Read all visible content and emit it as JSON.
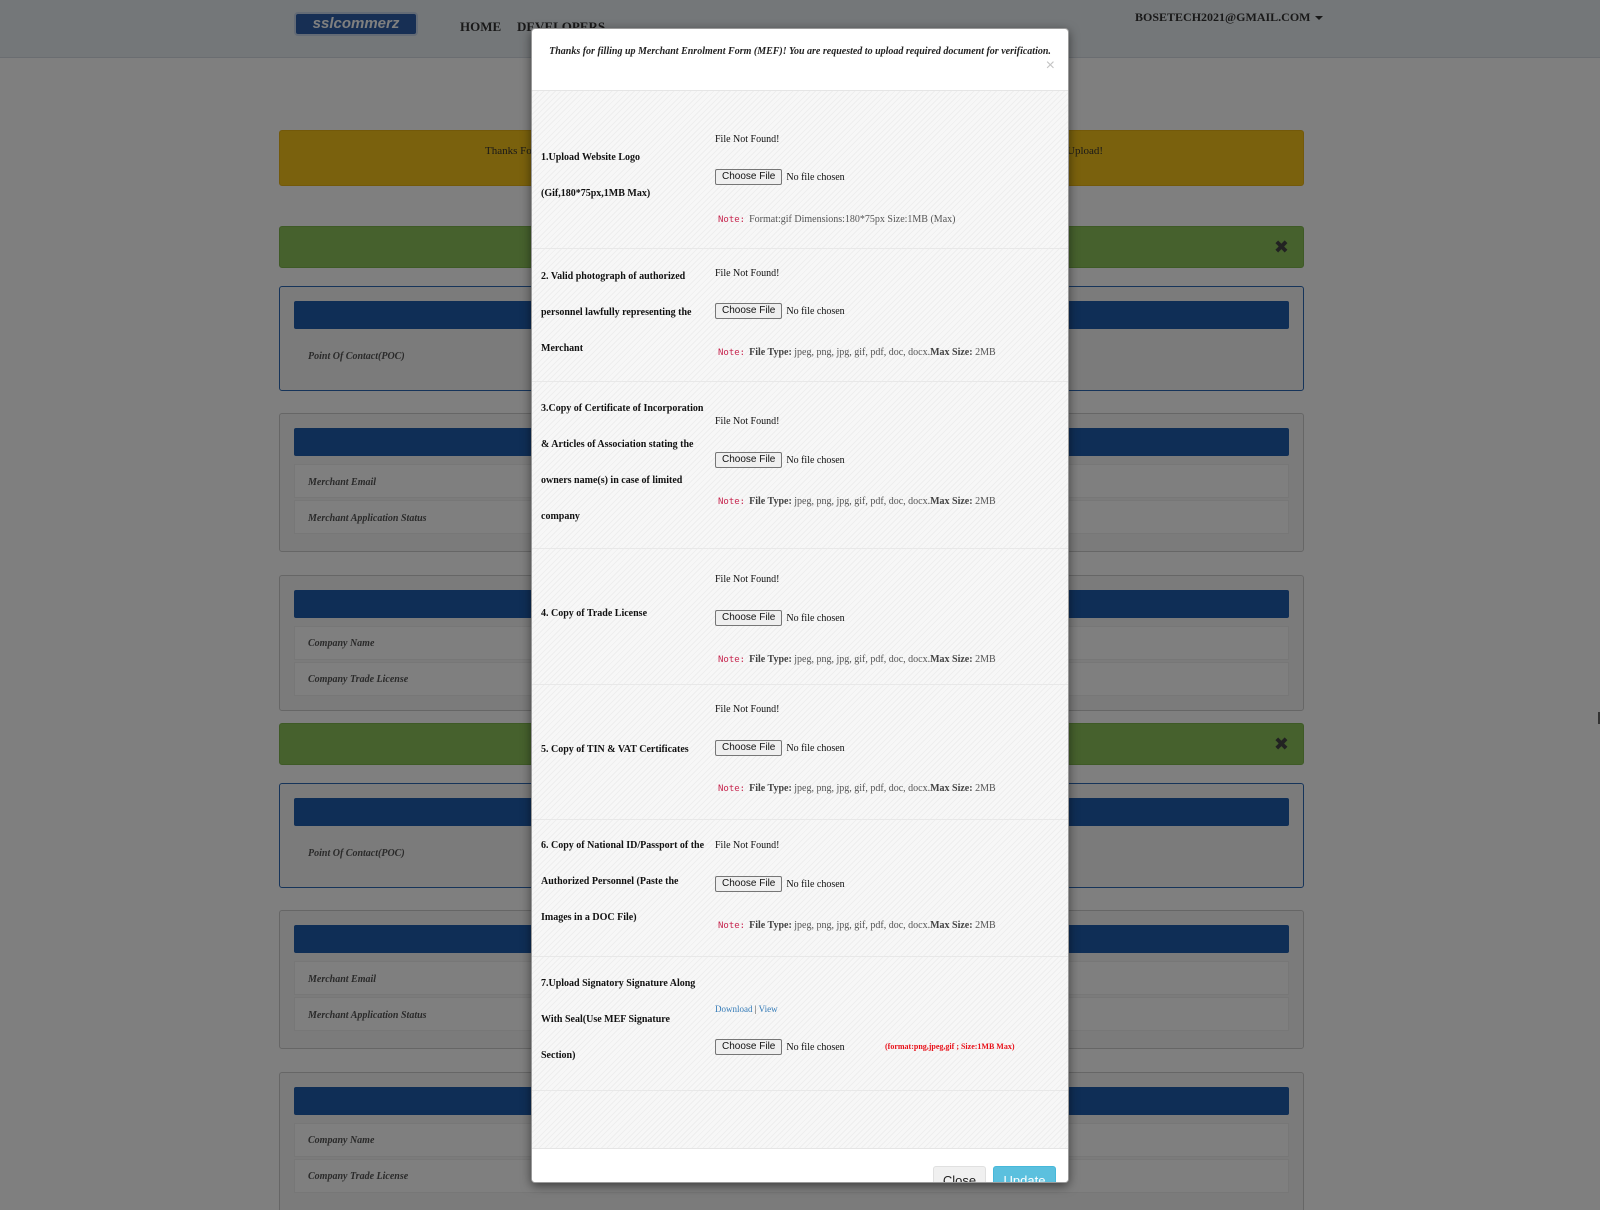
{
  "navbar": {
    "logo": "sslcommerz",
    "links": [
      "HOME",
      "DEVELOPERS"
    ],
    "user": "BOSETECH2021@GMAIL.COM"
  },
  "background": {
    "alert_left": "Thanks Fo",
    "alert_right": "Upload!",
    "labels": {
      "poc": "Point Of Contact(POC)",
      "merchant_email": "Merchant Email",
      "merchant_status": "Merchant Application Status",
      "company_name": "Company Name",
      "company_trade_license": "Company Trade License"
    }
  },
  "modal": {
    "title": "Thanks for filling up Merchant Enrolment Form (MEF)! You are requested to upload required document for verification.",
    "close_symbol": "×",
    "choose_label": "Choose File",
    "no_file_label": "No file chosen",
    "note_tag": "Note:",
    "file_type_label": "File Type:",
    "max_size_label": "Max Size:",
    "documents": [
      {
        "label_lines": [
          "1.Upload Website Logo",
          "(Gif,180*75px,1MB Max)"
        ],
        "status": "File Not Found!",
        "note_text": "Format:gif Dimensions:180*75px Size:1MB (Max)"
      },
      {
        "label_lines": [
          "2. Valid photograph of authorized",
          "personnel lawfully representing the",
          "Merchant"
        ],
        "status": "File Not Found!",
        "file_types": "jpeg, png, jpg, gif, pdf, doc, docx.",
        "max_size": "2MB"
      },
      {
        "label_lines": [
          "3.Copy of Certificate of Incorporation",
          "& Articles of Association stating the",
          "owners name(s) in case of limited",
          "company"
        ],
        "status": "File Not Found!",
        "file_types": "jpeg, png, jpg, gif, pdf, doc, docx.",
        "max_size": "2MB"
      },
      {
        "label_lines": [
          "4. Copy of Trade License"
        ],
        "status": "File Not Found!",
        "file_types": "jpeg, png, jpg, gif, pdf, doc, docx.",
        "max_size": "2MB"
      },
      {
        "label_lines": [
          "5. Copy of TIN & VAT Certificates"
        ],
        "status": "File Not Found!",
        "file_types": "jpeg, png, jpg, gif, pdf, doc, docx.",
        "max_size": "2MB"
      },
      {
        "label_lines": [
          "6. Copy of National ID/Passport of the",
          "Authorized Personnel (Paste the",
          "Images in a DOC File)"
        ],
        "status": "File Not Found!",
        "file_types": "jpeg, png, jpg, gif, pdf, doc, docx.",
        "max_size": "2MB"
      },
      {
        "label_lines": [
          "7.Upload Signatory Signature Along",
          "With Seal(Use MEF Signature",
          "Section)"
        ],
        "download_link": "Download",
        "view_link": "View",
        "format_note": "(format:png,jpeg,gif ; Size:1MB Max)"
      }
    ],
    "footer": {
      "close_button": "Close",
      "update_button": "Update"
    }
  }
}
